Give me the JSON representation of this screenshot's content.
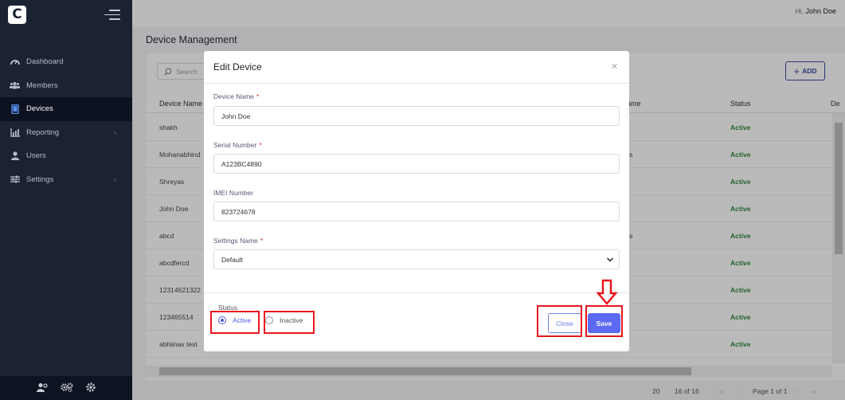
{
  "colors": {
    "sidebar": "#1b2233",
    "accent": "#5b6af0",
    "active_status": "#2f8a3a",
    "annotation": "#e8161e"
  },
  "sidebar": {
    "logo_letter": "C",
    "items": [
      {
        "label": "Dashboard",
        "icon": "dashboard-icon"
      },
      {
        "label": "Members",
        "icon": "members-icon"
      },
      {
        "label": "Devices",
        "icon": "devices-icon",
        "active": true
      },
      {
        "label": "Reporting",
        "icon": "reporting-icon",
        "has_submenu": true
      },
      {
        "label": "Users",
        "icon": "user-icon"
      },
      {
        "label": "Settings",
        "icon": "settings-icon",
        "has_submenu": true
      }
    ],
    "footer_icons": [
      "user-settings-icon",
      "gears-icon",
      "gear-icon"
    ]
  },
  "header": {
    "greeting": "Hi,",
    "user": "John Doe"
  },
  "page": {
    "title": "Device Management",
    "search_placeholder": "Search",
    "add_label": "ADD",
    "columns": [
      "Device Name",
      "ame",
      "Status",
      "De"
    ],
    "rows": [
      {
        "name": "shakh",
        "extra": "",
        "status": "Active"
      },
      {
        "name": "Mohanabhind",
        "extra": "ss",
        "status": "Active"
      },
      {
        "name": "Shreyas",
        "extra": "",
        "status": "Active"
      },
      {
        "name": "John Doe",
        "extra": "",
        "status": "Active"
      },
      {
        "name": "abcd",
        "extra": "ss",
        "status": "Active"
      },
      {
        "name": "abcdfercd",
        "extra": "",
        "status": "Active"
      },
      {
        "name": "12314621322",
        "extra": "",
        "status": "Active"
      },
      {
        "name": "123465514",
        "extra": "",
        "status": "Active"
      },
      {
        "name": "abhiinav test",
        "extra": "",
        "status": "Active"
      }
    ],
    "pager": {
      "page_size": "20",
      "range": "16 of 16",
      "page_text": "Page 1 of 1"
    }
  },
  "modal": {
    "title": "Edit Device",
    "fields": {
      "device_name": {
        "label": "Device Name",
        "value": "John Doe"
      },
      "serial_number": {
        "label": "Serial Number",
        "value": "A123BC4890"
      },
      "imei_number": {
        "label": "IMEI Number",
        "value": "823724678"
      },
      "settings_name": {
        "label": "Settings Name",
        "value": "Default"
      }
    },
    "status": {
      "label": "Status",
      "options": [
        "Active",
        "Inactive"
      ],
      "selected": "Active"
    },
    "close_label": "Close",
    "save_label": "Save"
  }
}
